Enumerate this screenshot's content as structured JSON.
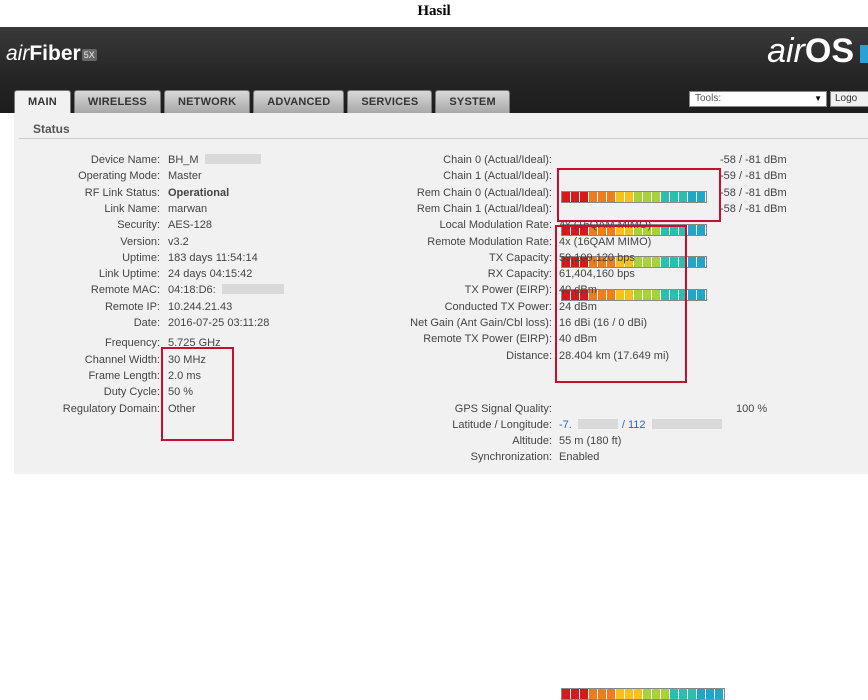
{
  "caption": "Hasil",
  "header": {
    "brand_left_air": "air",
    "brand_left_fiber": "Fiber",
    "brand_left_badge": "5X",
    "brand_right_air": "air",
    "brand_right_os": "OS"
  },
  "tabs": [
    {
      "label": "MAIN",
      "active": true
    },
    {
      "label": "WIRELESS"
    },
    {
      "label": "NETWORK"
    },
    {
      "label": "ADVANCED"
    },
    {
      "label": "SERVICES"
    },
    {
      "label": "SYSTEM"
    }
  ],
  "tools": {
    "label": "Tools:",
    "logout": "Logo"
  },
  "status_title": "Status",
  "left": [
    {
      "label": "Device Name:",
      "value": "BH_M"
    },
    {
      "label": "Operating Mode:",
      "value": "Master"
    },
    {
      "label": "RF Link Status:",
      "value": "Operational"
    },
    {
      "label": "Link Name:",
      "value": "marwan"
    },
    {
      "label": "Security:",
      "value": "AES-128"
    },
    {
      "label": "Version:",
      "value": "v3.2"
    },
    {
      "label": "Uptime:",
      "value": "183 days 11:54:14"
    },
    {
      "label": "Link Uptime:",
      "value": "24 days 04:15:42"
    },
    {
      "label": "Remote MAC:",
      "value": "04:18:D6:"
    },
    {
      "label": "Remote IP:",
      "value": "10.244.21.43"
    },
    {
      "label": "Date:",
      "value": "2016-07-25 03:11:28"
    },
    {
      "label": "Frequency:",
      "value": "5.725 GHz"
    },
    {
      "label": "Channel Width:",
      "value": "30 MHz"
    },
    {
      "label": "Frame Length:",
      "value": "2.0 ms"
    },
    {
      "label": "Duty Cycle:",
      "value": "50 %"
    },
    {
      "label": "Regulatory Domain:",
      "value": "Other"
    }
  ],
  "chains": [
    {
      "label": "Chain 0 (Actual/Ideal):",
      "value": "-58 / -81 dBm",
      "level": 1.0
    },
    {
      "label": "Chain 1 (Actual/Ideal):",
      "value": "-59 / -81 dBm",
      "level": 1.0
    },
    {
      "label": "Rem Chain 0 (Actual/Ideal):",
      "value": "-58 / -81 dBm",
      "level": 1.0
    },
    {
      "label": "Rem Chain 1 (Actual/Ideal):",
      "value": "-58 / -81 dBm",
      "level": 1.0
    }
  ],
  "right": [
    {
      "label": "Local Modulation Rate:",
      "value": "4x (16QAM MIMO)"
    },
    {
      "label": "Remote Modulation Rate:",
      "value": "4x (16QAM MIMO)"
    },
    {
      "label": "TX Capacity:",
      "value": "59,109,120 bps"
    },
    {
      "label": "RX Capacity:",
      "value": "61,404,160 bps"
    },
    {
      "label": "TX Power (EIRP):",
      "value": "40 dBm"
    },
    {
      "label": "Conducted TX Power:",
      "value": "24 dBm"
    },
    {
      "label": "Net Gain (Ant Gain/Cbl loss):",
      "value": "16 dBi (16 / 0 dBi)"
    },
    {
      "label": "Remote TX Power (EIRP):",
      "value": "40 dBm"
    },
    {
      "label": "Distance:",
      "value": "28.404 km (17.649 mi)"
    }
  ],
  "gps": {
    "quality_label": "GPS Signal Quality:",
    "quality_value": "100 %",
    "quality_level": 1.0,
    "latlon_label": "Latitude / Longitude:",
    "lat_value": "-7.",
    "lon_value": "/ 112",
    "altitude_label": "Altitude:",
    "altitude_value": "55 m (180 ft)",
    "sync_label": "Synchronization:",
    "sync_value": "Enabled"
  },
  "colors": {
    "highlight_box": "#c8102e",
    "signal_gradient": [
      "#d7191c",
      "#f07d1b",
      "#f6c21a",
      "#a8d13a",
      "#2bbfb0",
      "#20a7c8"
    ]
  }
}
